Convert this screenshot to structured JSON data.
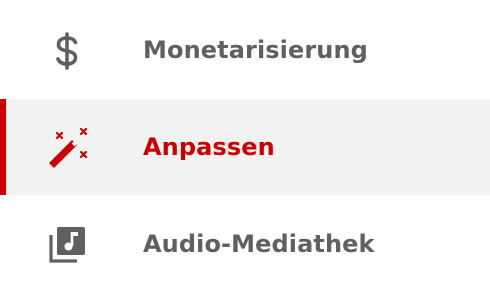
{
  "colors": {
    "text": "#606060",
    "active": "#cc0000",
    "active_background": "#f2f2f2"
  },
  "nav": {
    "items": [
      {
        "label": "Monetarisierung",
        "icon": "dollar-icon",
        "active": false
      },
      {
        "label": "Anpassen",
        "icon": "magic-wand-icon",
        "active": true
      },
      {
        "label": "Audio-Mediathek",
        "icon": "audio-library-icon",
        "active": false
      }
    ]
  }
}
